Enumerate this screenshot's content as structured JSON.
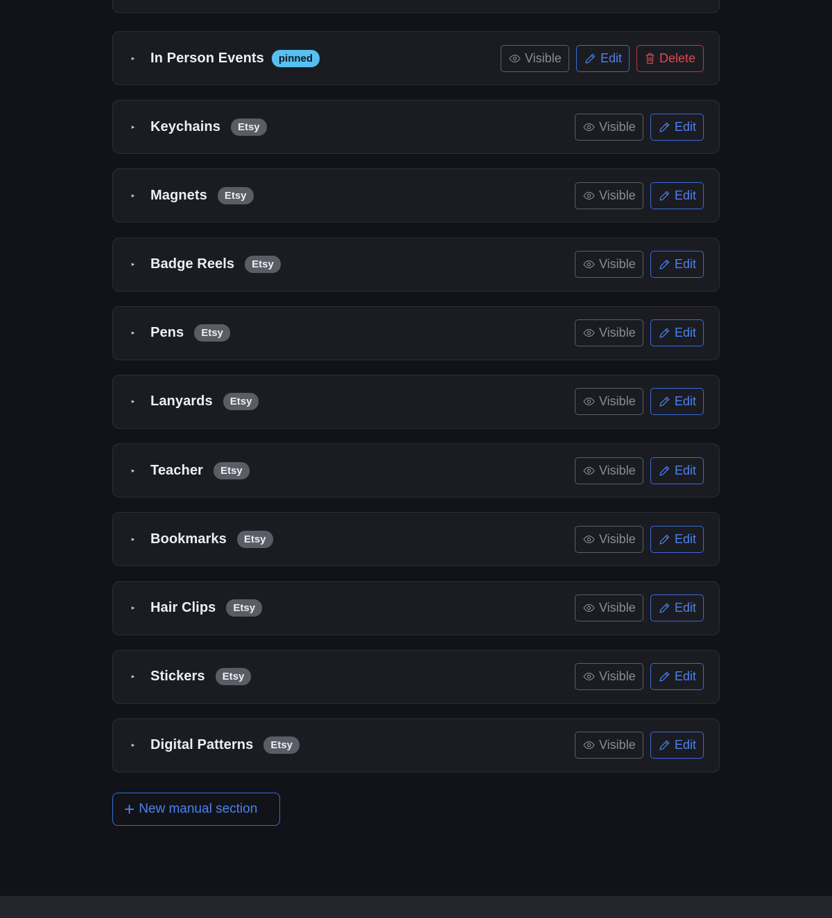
{
  "colors": {
    "background": "#121318",
    "card": "#1b1c21",
    "accent_blue": "#4b82f0",
    "danger_red": "#dd4a52",
    "pinned_badge": "#56c0f0",
    "etsy_badge": "#5a5d66"
  },
  "sections": [
    {
      "title": "In Person Events",
      "badge": "pinned",
      "badge_type": "pinned",
      "visible_label": "Visible",
      "edit_label": "Edit",
      "delete_label": "Delete",
      "has_delete": true
    },
    {
      "title": "Keychains",
      "badge": "Etsy",
      "badge_type": "etsy",
      "visible_label": "Visible",
      "edit_label": "Edit"
    },
    {
      "title": "Magnets",
      "badge": "Etsy",
      "badge_type": "etsy",
      "visible_label": "Visible",
      "edit_label": "Edit"
    },
    {
      "title": "Badge Reels",
      "badge": "Etsy",
      "badge_type": "etsy",
      "visible_label": "Visible",
      "edit_label": "Edit"
    },
    {
      "title": "Pens",
      "badge": "Etsy",
      "badge_type": "etsy",
      "visible_label": "Visible",
      "edit_label": "Edit"
    },
    {
      "title": "Lanyards",
      "badge": "Etsy",
      "badge_type": "etsy",
      "visible_label": "Visible",
      "edit_label": "Edit"
    },
    {
      "title": "Teacher",
      "badge": "Etsy",
      "badge_type": "etsy",
      "visible_label": "Visible",
      "edit_label": "Edit"
    },
    {
      "title": "Bookmarks",
      "badge": "Etsy",
      "badge_type": "etsy",
      "visible_label": "Visible",
      "edit_label": "Edit"
    },
    {
      "title": "Hair Clips",
      "badge": "Etsy",
      "badge_type": "etsy",
      "visible_label": "Visible",
      "edit_label": "Edit"
    },
    {
      "title": "Stickers",
      "badge": "Etsy",
      "badge_type": "etsy",
      "visible_label": "Visible",
      "edit_label": "Edit"
    },
    {
      "title": "Digital Patterns",
      "badge": "Etsy",
      "badge_type": "etsy",
      "visible_label": "Visible",
      "edit_label": "Edit"
    }
  ],
  "new_section_label": "New manual section",
  "icons": {
    "caret": "caret-right-icon",
    "visible": "eye-icon",
    "edit": "pencil-icon",
    "delete": "trash-icon",
    "add": "plus-icon"
  }
}
